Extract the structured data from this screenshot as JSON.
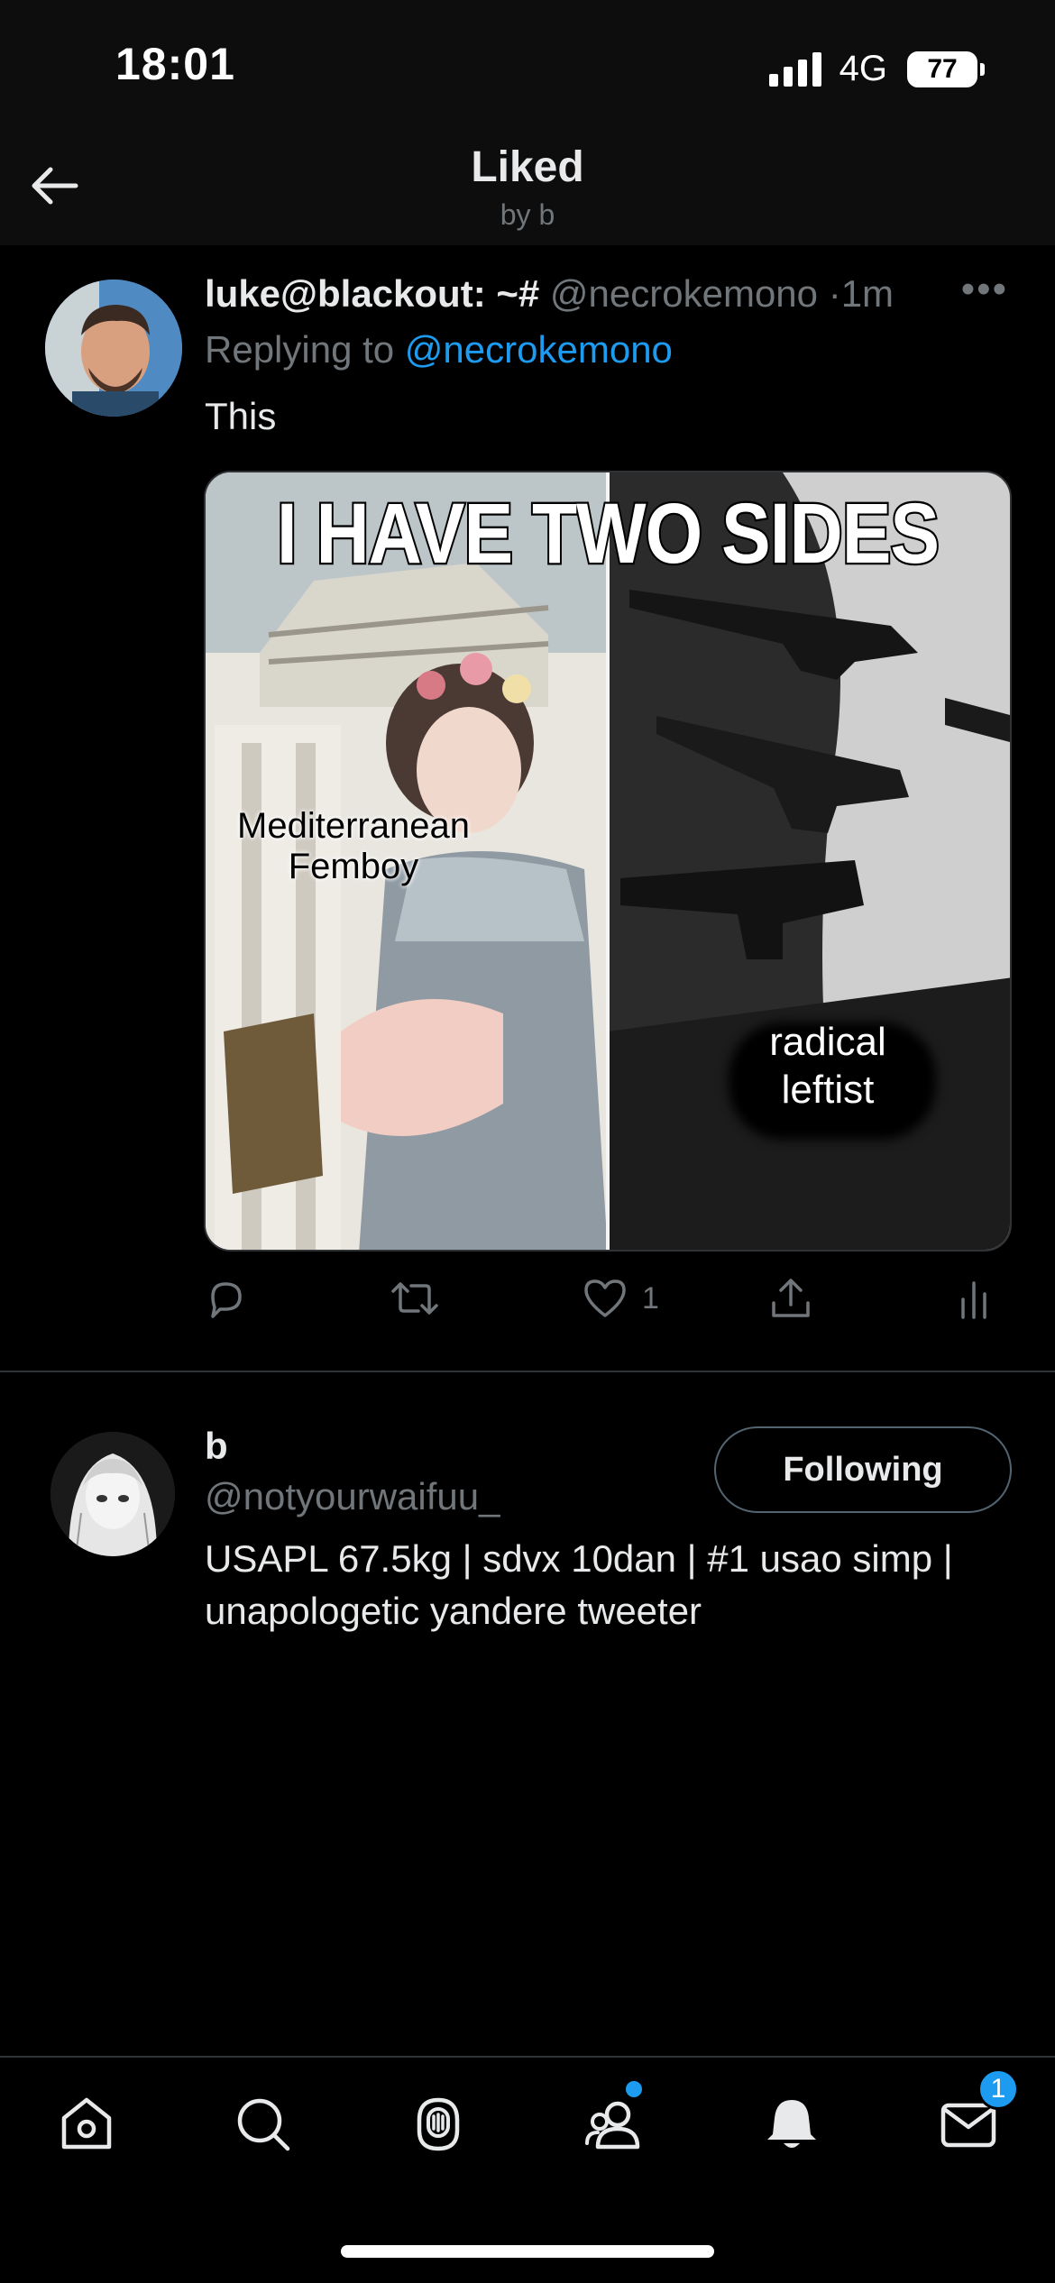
{
  "status_bar": {
    "time": "18:01",
    "network": "4G",
    "battery": "77"
  },
  "header": {
    "title": "Liked",
    "subtitle": "by b"
  },
  "tweet": {
    "display_name": "luke@blackout: ~#",
    "handle": "@necrokemono",
    "separator": "·",
    "time": "1m",
    "replying_prefix": "Replying to",
    "replying_to": "@necrokemono",
    "text": "This",
    "media": {
      "title": "I HAVE TWO SIDES",
      "left_label": "Mediterranean Femboy",
      "right_label": "radical leftist"
    },
    "actions": {
      "like_count": "1"
    }
  },
  "profile": {
    "name": "b",
    "handle": "@notyourwaifuu_",
    "follow_label": "Following",
    "bio": "USAPL 67.5kg | sdvx 10dan | #1 usao simp | unapologetic yandere tweeter"
  },
  "tabbar": {
    "items": [
      "home-icon",
      "search-icon",
      "spaces-icon",
      "communities-icon",
      "notifications-icon",
      "messages-icon"
    ],
    "messages_badge": "1"
  },
  "colors": {
    "accent": "#1d9bf0",
    "background": "#000000",
    "muted": "#71767b"
  }
}
